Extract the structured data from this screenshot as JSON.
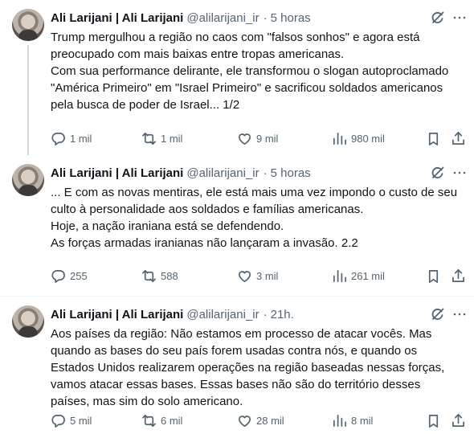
{
  "tweets": [
    {
      "name": "Ali Larijani | Ali Larijani",
      "handle": "@alilarijani_ir",
      "separator": "·",
      "time": "5 horas",
      "lines": [
        "Trump mergulhou a região no caos com \"falsos sonhos\" e agora está",
        "preocupado com mais baixas entre tropas americanas.",
        "Com sua performance delirante, ele transformou o slogan autoproclamado",
        "\"América Primeiro\" em \"Israel Primeiro\" e sacrificou soldados americanos",
        "pela busca de poder de Israel... 1/2"
      ],
      "replies": "1 mil",
      "reposts": "1 mil",
      "likes": "9 mil",
      "views": "980 mil"
    },
    {
      "name": "Ali Larijani | Ali Larijani",
      "handle": "@alilarijani_ir",
      "separator": "·",
      "time": "5 horas",
      "lines": [
        "... E com as novas mentiras, ele está mais uma vez impondo o custo de seu",
        "culto à personalidade aos soldados e famílias americanas.",
        "Hoje, a nação iraniana está se defendendo.",
        "As forças armadas iranianas não lançaram a invasão. 2.2"
      ],
      "replies": "255",
      "reposts": "588",
      "likes": "3 mil",
      "views": "261 mil"
    },
    {
      "name": "Ali Larijani | Ali Larijani",
      "handle": "@alilarijani_ir",
      "separator": "·",
      "time": "21h.",
      "lines": [
        "Aos países da região: Não estamos em processo de atacar vocês. Mas",
        "quando as bases do seu país forem usadas contra nós, e quando os",
        "Estados Unidos realizarem operações na região baseadas nessas forças,",
        "vamos atacar essas bases. Essas bases não são do território desses",
        "países, mas sim do solo americano."
      ],
      "replies": "5 mil",
      "reposts": "6 mil",
      "likes": "28 mil",
      "views": "8 mil"
    }
  ],
  "icons": {
    "reply": "comment-bubble-icon",
    "repost": "repost-arrows-icon",
    "like": "heart-icon",
    "views": "bar-chart-icon",
    "bookmark": "bookmark-icon",
    "share": "share-upload-icon",
    "grok": "grok-slash-circle-icon",
    "more": "more-dots-icon"
  },
  "colors": {
    "text": "#0f1419",
    "secondary": "#536471",
    "thread_line": "#cfd9de",
    "divider": "#eff3f4"
  }
}
